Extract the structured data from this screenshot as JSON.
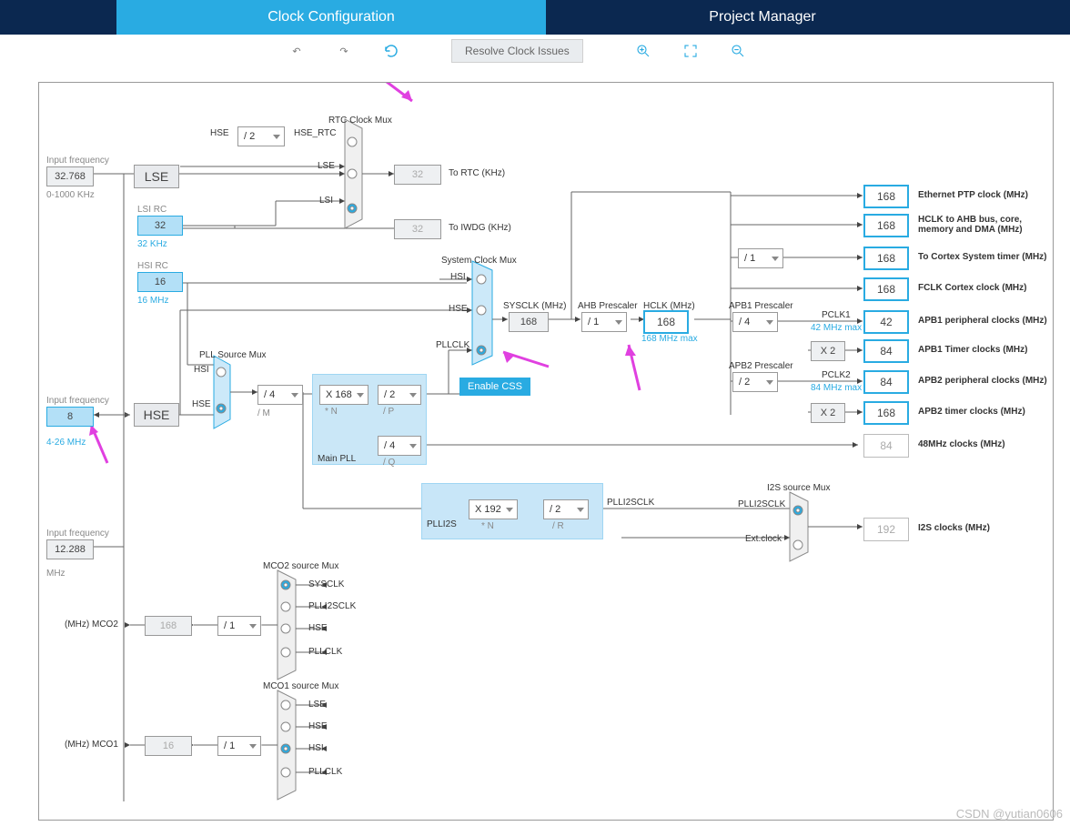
{
  "tabs": {
    "clock": "Clock Configuration",
    "pm": "Project Manager"
  },
  "toolbar": {
    "resolve": "Resolve Clock Issues"
  },
  "left": {
    "if1_label": "Input frequency",
    "if1_val": "32.768",
    "if1_range": "0-1000 KHz",
    "lse": "LSE",
    "lsi_rc": "LSI RC",
    "lsi_val": "32",
    "lsi_range": "32 KHz",
    "hsi_rc": "HSI RC",
    "hsi_val": "16",
    "hsi_range": "16 MHz",
    "if2_label": "Input frequency",
    "if2_val": "8",
    "if2_range": "4-26 MHz",
    "hse": "HSE",
    "if3_label": "Input frequency",
    "if3_val": "12.288",
    "if3_unit": "MHz"
  },
  "rtc": {
    "title": "RTC Clock Mux",
    "hse": "HSE",
    "div": "/ 2",
    "hse_rtc": "HSE_RTC",
    "lse": "LSE",
    "lsi": "LSI",
    "to_rtc": "To RTC (KHz)",
    "to_rtc_v": "32",
    "to_iwdg": "To IWDG (KHz)",
    "to_iwdg_v": "32"
  },
  "pll": {
    "src_title": "PLL Source Mux",
    "hsi": "HSI",
    "hse": "HSE",
    "m": "/ 4",
    "m_lbl": "/ M",
    "main_title": "Main PLL",
    "n": "X 168",
    "n_lbl": "* N",
    "p": "/ 2",
    "p_lbl": "/ P",
    "q": "/ 4",
    "q_lbl": "/ Q"
  },
  "sys": {
    "title": "System Clock Mux",
    "hsi": "HSI",
    "hse": "HSE",
    "pllclk": "PLLCLK",
    "css": "Enable CSS",
    "sysclk_lbl": "SYSCLK (MHz)",
    "sysclk_v": "168"
  },
  "ahb": {
    "lbl": "AHB Prescaler",
    "v": "/ 1",
    "hclk_lbl": "HCLK (MHz)",
    "hclk_v": "168",
    "hclk_max": "168 MHz max"
  },
  "apb1": {
    "lbl": "APB1 Prescaler",
    "v": "/ 4",
    "pclk_lbl": "PCLK1",
    "pclk_max": "42 MHz max",
    "x2": "X 2"
  },
  "apb2": {
    "lbl": "APB2 Prescaler",
    "v": "/ 2",
    "pclk_lbl": "PCLK2",
    "pclk_max": "84 MHz max",
    "x2": "X 2"
  },
  "outs": {
    "eth": "Ethernet PTP clock (MHz)",
    "eth_v": "168",
    "hclk_ahb": "HCLK to AHB bus, core, memory and DMA (MHz)",
    "hclk_ahb_v": "168",
    "cortex_div": "/ 1",
    "cortex": "To Cortex System timer (MHz)",
    "cortex_v": "168",
    "fclk": "FCLK Cortex clock (MHz)",
    "fclk_v": "168",
    "apb1p": "APB1 peripheral clocks (MHz)",
    "apb1p_v": "42",
    "apb1t": "APB1 Timer clocks (MHz)",
    "apb1t_v": "84",
    "apb2p": "APB2 peripheral clocks (MHz)",
    "apb2p_v": "84",
    "apb2t": "APB2 timer clocks (MHz)",
    "apb2t_v": "168",
    "mhz48": "48MHz clocks (MHz)",
    "mhz48_v": "84"
  },
  "plli2s": {
    "title": "PLLI2S",
    "n": "X 192",
    "n_lbl": "* N",
    "r": "/ 2",
    "r_lbl": "/ R",
    "clk": "PLLI2SCLK"
  },
  "i2s": {
    "title": "I2S source Mux",
    "ext": "Ext.clock",
    "plli2sclk": "PLLI2SCLK",
    "out": "I2S clocks (MHz)",
    "out_v": "192"
  },
  "mco2": {
    "title": "MCO2 source Mux",
    "sysclk": "SYSCLK",
    "plli2sclk": "PLLI2SCLK",
    "hse": "HSE",
    "pllclk": "PLLCLK",
    "div": "/ 1",
    "lbl": "(MHz) MCO2",
    "v": "168"
  },
  "mco1": {
    "title": "MCO1 source Mux",
    "lse": "LSE",
    "hse": "HSE",
    "hsi": "HSI",
    "pllclk": "PLLCLK",
    "div": "/ 1",
    "lbl": "(MHz) MCO1",
    "v": "16"
  },
  "watermark": "CSDN @yutian0606"
}
